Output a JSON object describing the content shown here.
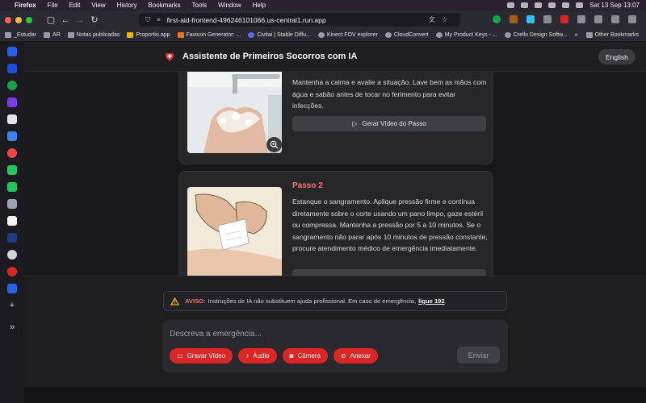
{
  "menubar": {
    "app_name": "Firefox",
    "items": [
      "File",
      "Edit",
      "View",
      "History",
      "Bookmarks",
      "Tools",
      "Window",
      "Help"
    ],
    "datetime": "Sat 13 Sep  13:07"
  },
  "browser": {
    "url": "first-aid-frontend-496246101066.us-central1.run.app",
    "bookmarks": [
      "_Estudar",
      "AR",
      "Notas publicadas",
      "Proportio.app",
      "Favicon Generator: ...",
      "Civitai | Stable Diffu...",
      "Kinect FOV explorer",
      "CloudConvert",
      "My Product Keys - ...",
      "Crello Design Softw..."
    ],
    "other_bookmarks": "Other Bookmarks"
  },
  "header": {
    "title": "Assistente de Primeiros Socorros com IA",
    "language_button": "English"
  },
  "steps": [
    {
      "title": "",
      "text": "Mantenha a calma e avalie a situação. Lave bem as mãos com água e sabão antes de tocar no ferimento para evitar infecções.",
      "video_button": "Gerar Vídeo do Passo"
    },
    {
      "title": "Passo 2",
      "text": "Estanque o sangramento. Aplique pressão firme e contínua diretamente sobre o corte usando um pano limpo, gaze estéril ou compressa. Mantenha a pressão por 5 a 10 minutos. Se o sangramento não parar após 10 minutos de pressão constante, procure atendimento médico de emergência imediatamente."
    }
  ],
  "disclaimer": {
    "label": "AVISO:",
    "text": "Instruções de IA não substituem ajuda profissional. Em caso de emergência,",
    "link": "ligue 192",
    "end": "."
  },
  "composer": {
    "placeholder": "Descreva a emergência...",
    "record_video": "Gravar Vídeo",
    "audio": "Áudio",
    "camera": "Câmera",
    "attach": "Anexar",
    "send": "Enviar"
  },
  "colors": {
    "accent": "#dc2626",
    "step_title": "#f87171",
    "card": "#27272a",
    "background": "#18181b"
  }
}
